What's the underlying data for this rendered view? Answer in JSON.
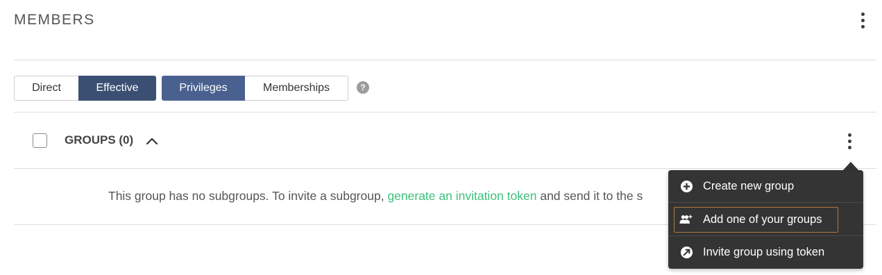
{
  "section": {
    "title": "MEMBERS",
    "menu_icon": "kebab-menu-icon"
  },
  "view_tabs": [
    {
      "label": "Direct",
      "active": false
    },
    {
      "label": "Effective",
      "active": true
    }
  ],
  "type_tabs": [
    {
      "label": "Privileges",
      "active": true
    },
    {
      "label": "Memberships",
      "active": false
    }
  ],
  "help": {
    "glyph": "?"
  },
  "groups": {
    "label": "GROUPS (0)",
    "expanded": true,
    "empty_message_prefix": "This group has no subgroups. To invite a subgroup, ",
    "empty_message_link": "generate an invitation token",
    "empty_message_suffix": " and send it to the s"
  },
  "dropdown_menu": {
    "items": [
      {
        "label": "Create new group",
        "icon": "plus-circle-icon"
      },
      {
        "label": "Add one of your groups",
        "icon": "add-users-icon",
        "highlighted": true
      },
      {
        "label": "Invite group using token",
        "icon": "token-link-icon"
      }
    ]
  },
  "colors": {
    "active_tab": "#3b4f72",
    "active_tab_light": "#4a6190",
    "link": "#3cc07a",
    "menu_bg": "#343434",
    "highlight_border": "#b07a3c"
  }
}
